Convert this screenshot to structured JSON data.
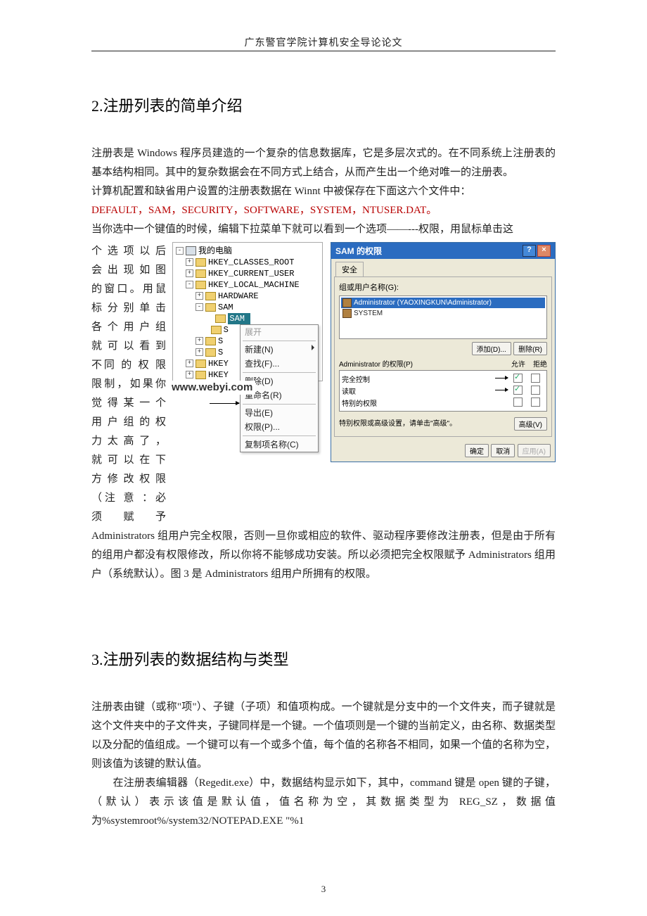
{
  "header": "广东警官学院计算机安全导论论文",
  "section2": {
    "title": "2.注册列表的简单介绍",
    "p1": "注册表是 Windows 程序员建造的一个复杂的信息数据库，它是多层次式的。在不同系统上注册表的基本结构相同。其中的复杂数据会在不同方式上结合，从而产生出一个绝对唯一的注册表。",
    "p2": "计算机配置和缺省用户设置的注册表数据在 Winnt 中被保存在下面这六个文件中：",
    "p2_red": "DEFAULT，SAM，SECURITY，SOFTWARE，SYSTEM，NTUSER.DAT。",
    "p3": "当你选中一个键值的时候，编辑下拉菜单下就可以看到一个选项——---权限，用鼠标单击这",
    "side_lines": [
      "个 选 项 以 后",
      "会 出 现 如 图",
      "的窗口。用鼠",
      "标 分 别 单 击",
      "各 个 用 户 组",
      "就 可 以 看 到",
      "不同 的 权 限",
      "限制，如果你",
      "觉 得 某 一 个",
      "用 户 组 的 权",
      "力 太 高 了 ，",
      "就 可 以 在 下",
      "方 修 改 权 限",
      "（注 意 ：必",
      "须 赋 予"
    ],
    "after_fig": "Administrators 组用户完全权限，否则一旦你或相应的软件、驱动程序要修改注册表，但是由于所有的组用户都没有权限修改，所以你将不能够成功安装。所以必须把完全权限赋予 Administrators 组用户（系统默认）。图 3 是 Administrators 组用户所拥有的权限。"
  },
  "tree": {
    "root": "我的电脑",
    "k1": "HKEY_CLASSES_ROOT",
    "k2": "HKEY_CURRENT_USER",
    "k3": "HKEY_LOCAL_MACHINE",
    "k3a": "HARDWARE",
    "k3b": "SAM",
    "k3b_sel": "SAM",
    "k3c": "S",
    "k3d": "S",
    "k3e": "S",
    "k4": "HKEY",
    "k5": "HKEY",
    "watermark": "www.webyi.com"
  },
  "context_menu": {
    "open": "展开",
    "new": "新建(N)",
    "find": "查找(F)...",
    "delete": "删除(D)",
    "rename": "重命名(R)",
    "export": "导出(E)",
    "perm": "权限(P)...",
    "copy": "复制项名称(C)"
  },
  "dialog": {
    "title": "SAM 的权限",
    "tab": "安全",
    "group_label": "组或用户名称(G):",
    "user1": "Administrator (YAOXINGKUN\\Administrator)",
    "user2": "SYSTEM",
    "add_btn": "添加(D)...",
    "remove_btn": "删除(R)",
    "perm_label": "Administrator 的权限(P)",
    "allow": "允许",
    "deny": "拒绝",
    "perm1": "完全控制",
    "perm2": "读取",
    "perm3": "特别的权限",
    "spec_note": "特别权限或高级设置，请单击\"高级\"。",
    "adv_btn": "高级(V)",
    "ok_btn": "确定",
    "cancel_btn": "取消",
    "apply_btn": "应用(A)"
  },
  "section3": {
    "title": "3.注册列表的数据结构与类型",
    "p1": "注册表由键（或称\"项\"）、子键（子项）和值项构成。一个键就是分支中的一个文件夹，而子键就是这个文件夹中的子文件夹，子键同样是一个键。一个值项则是一个键的当前定义，由名称、数据类型以及分配的值组成。一个键可以有一个或多个值，每个值的名称各不相同，如果一个值的名称为空，则该值为该键的默认值。",
    "p2": "　　在注册表编辑器（Regedit.exe）中，数据结构显示如下，其中，command 键是 open 键的子键，（默认）表示该值是默认值，值名称为空，其数据类型为 REG_SZ，数据值为%systemroot%/system32/NOTEPAD.EXE \"%1"
  },
  "page_number": "3"
}
